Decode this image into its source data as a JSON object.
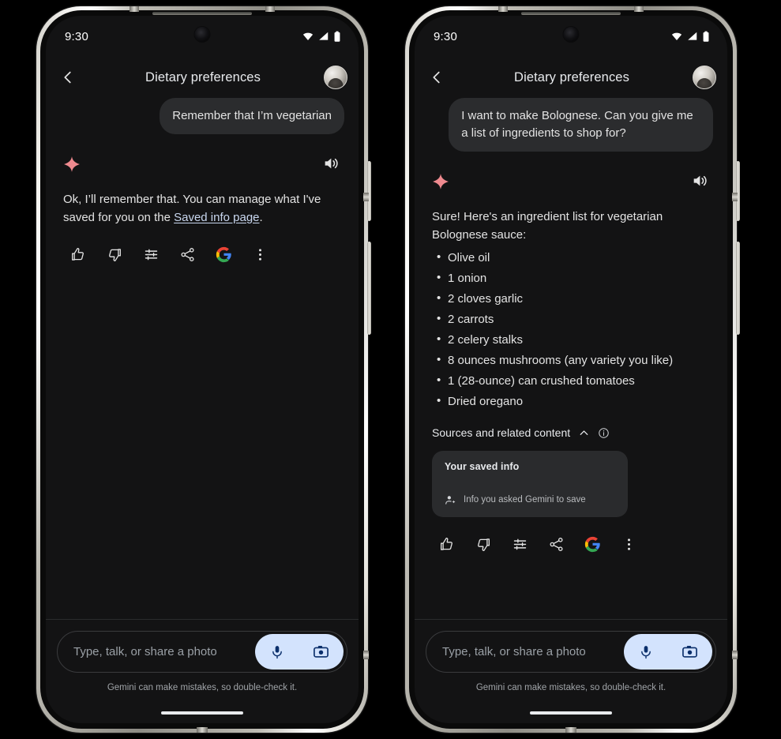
{
  "theme": {
    "screen_bg": "#131314",
    "bubble_bg": "#2b2c2e",
    "text_primary": "#e3e3e3",
    "link_color": "#c9d7ef",
    "sparkle_color": "#ef8a8f",
    "accent_pill_bg": "#d3e3fd",
    "accent_pill_fg": "#0b2f6b",
    "frame_metal": "#cfcdc6"
  },
  "phones": [
    {
      "id": "phone-left",
      "status_bar": {
        "clock": "9:30",
        "icons": [
          "wifi-icon",
          "cellular-signal-icon",
          "battery-icon"
        ]
      },
      "app_bar": {
        "back_icon": "chevron-left-icon",
        "title": "Dietary preferences",
        "avatar_label": "account-avatar"
      },
      "user_message": "Remember that I’m vegetarian",
      "gemini": {
        "sparkle_icon": "gemini-sparkle-icon",
        "speaker_icon": "volume-up-icon",
        "answer_prefix": "Ok, I’ll remember that. You can manage what I've saved for you on the ",
        "answer_link": "Saved info page",
        "answer_suffix": "."
      },
      "actions": [
        {
          "icon": "thumb-up-icon",
          "label": "Good response"
        },
        {
          "icon": "thumb-down-icon",
          "label": "Bad response"
        },
        {
          "icon": "tune-sliders-icon",
          "label": "Modify response"
        },
        {
          "icon": "share-icon",
          "label": "Share"
        },
        {
          "icon": "google-g-icon",
          "label": "Google it"
        },
        {
          "icon": "more-vert-icon",
          "label": "More"
        }
      ],
      "composer": {
        "placeholder": "Type, talk, or share a photo",
        "mic_icon": "microphone-icon",
        "camera_icon": "camera-icon"
      },
      "disclaimer": "Gemini can make mistakes, so double-check it."
    },
    {
      "id": "phone-right",
      "status_bar": {
        "clock": "9:30",
        "icons": [
          "wifi-icon",
          "cellular-signal-icon",
          "battery-icon"
        ]
      },
      "app_bar": {
        "back_icon": "chevron-left-icon",
        "title": "Dietary preferences",
        "avatar_label": "account-avatar"
      },
      "user_message": "I want to make Bolognese. Can you give me a list of ingredients to shop for?",
      "gemini": {
        "sparkle_icon": "gemini-sparkle-icon",
        "speaker_icon": "volume-up-icon",
        "intro": "Sure! Here's an ingredient list for vegetarian Bolognese sauce:",
        "ingredients": [
          "Olive oil",
          "1 onion",
          "2 cloves garlic",
          "2 carrots",
          "2 celery stalks",
          "8 ounces mushrooms (any variety you like)",
          "1 (28-ounce) can crushed tomatoes",
          "Dried oregano"
        ]
      },
      "sources": {
        "label": "Sources and related content",
        "collapse_icon": "chevron-up-icon",
        "info_icon": "info-circle-icon",
        "card": {
          "title": "Your saved info",
          "item_icon": "person-add-sparkle-icon",
          "item_text": "Info you asked Gemini to save"
        }
      },
      "actions": [
        {
          "icon": "thumb-up-icon",
          "label": "Good response"
        },
        {
          "icon": "thumb-down-icon",
          "label": "Bad response"
        },
        {
          "icon": "tune-sliders-icon",
          "label": "Modify response"
        },
        {
          "icon": "share-icon",
          "label": "Share"
        },
        {
          "icon": "google-g-icon",
          "label": "Google it"
        },
        {
          "icon": "more-vert-icon",
          "label": "More"
        }
      ],
      "composer": {
        "placeholder": "Type, talk, or share a photo",
        "mic_icon": "microphone-icon",
        "camera_icon": "camera-icon"
      },
      "disclaimer": "Gemini can make mistakes, so double-check it."
    }
  ]
}
